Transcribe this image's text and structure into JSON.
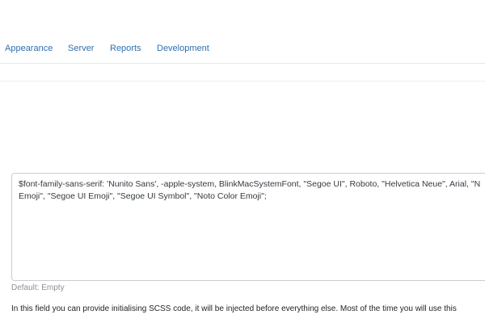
{
  "tabs": [
    {
      "label": "Appearance"
    },
    {
      "label": "Server"
    },
    {
      "label": "Reports"
    },
    {
      "label": "Development"
    }
  ],
  "colors": {
    "tab_link": "#2f6fb2",
    "border": "#c8cdd2",
    "muted_text": "#8a9096"
  },
  "scss_field": {
    "value_lines": [
      "$font-family-sans-serif: 'Nunito Sans', -apple-system, BlinkMacSystemFont, \"Segoe UI\", Roboto, \"Helvetica Neue\", Arial, \"N",
      "Emoji\", \"Segoe UI Emoji\", \"Segoe UI Symbol\", \"Noto Color Emoji\";"
    ],
    "default_note": "Default: Empty",
    "help_text": "In this field you can provide initialising SCSS code, it will be injected before everything else. Most of the time you will use this"
  }
}
